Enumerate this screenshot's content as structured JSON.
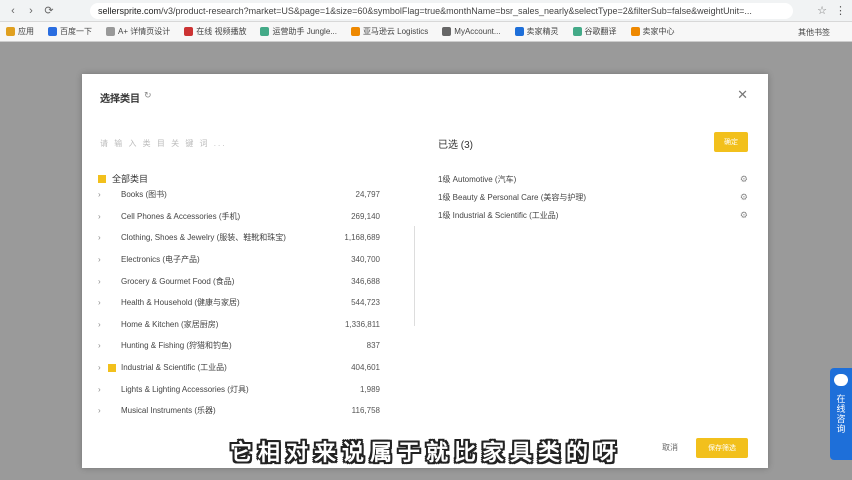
{
  "browser": {
    "url_host": "sellersprite.com",
    "url_path": "/v3/product-research?market=US&page=1&size=60&symbolFlag=true&monthName=bsr_sales_nearly&selectType=2&filterSub=false&weightUnit=..."
  },
  "bookmarks": [
    {
      "label": "应用",
      "color": "#e0a020"
    },
    {
      "label": "百度一下",
      "color": "#2a6de0"
    },
    {
      "label": "A+ 详情页设计",
      "color": "#999"
    },
    {
      "label": "在线 视频播放",
      "color": "#c33"
    },
    {
      "label": "运营助手 Jungle...",
      "color": "#4a8"
    },
    {
      "label": "亚马逊云 Logistics",
      "color": "#e80"
    },
    {
      "label": "MyAccount...",
      "color": "#666"
    },
    {
      "label": "卖家精灵",
      "color": "#1e6fd9"
    },
    {
      "label": "谷歌翻译",
      "color": "#4a8"
    },
    {
      "label": "卖家中心",
      "color": "#e80"
    }
  ],
  "bookmarks_other": "其他书签",
  "modal": {
    "title": "选择类目",
    "search_placeholder": "请 输 入 类 目 关 键 词 ...",
    "all_label": "全部类目",
    "selected_title": "已选 (3)",
    "confirm_label": "确定",
    "cancel_label": "取消",
    "save_label": "保存筛选"
  },
  "categories": [
    {
      "name": "Books (图书)",
      "count": "24,797",
      "checked": false
    },
    {
      "name": "Cell Phones & Accessories (手机)",
      "count": "269,140",
      "checked": false
    },
    {
      "name": "Clothing, Shoes & Jewelry (服装、鞋靴和珠宝)",
      "count": "1,168,689",
      "checked": false
    },
    {
      "name": "Electronics (电子产品)",
      "count": "340,700",
      "checked": false
    },
    {
      "name": "Grocery & Gourmet Food (食品)",
      "count": "346,688",
      "checked": false
    },
    {
      "name": "Health & Household (健康与家居)",
      "count": "544,723",
      "checked": false
    },
    {
      "name": "Home & Kitchen (家居厨房)",
      "count": "1,336,811",
      "checked": false
    },
    {
      "name": "Hunting & Fishing (狩猎和钓鱼)",
      "count": "837",
      "checked": false
    },
    {
      "name": "Industrial & Scientific (工业品)",
      "count": "404,601",
      "checked": true
    },
    {
      "name": "Lights & Lighting Accessories (灯具)",
      "count": "1,989",
      "checked": false
    },
    {
      "name": "Musical Instruments (乐器)",
      "count": "116,758",
      "checked": false
    }
  ],
  "selected": [
    {
      "label": "1级 Automotive (汽车)"
    },
    {
      "label": "1级 Beauty & Personal Care (美容与护理)"
    },
    {
      "label": "1级 Industrial & Scientific (工业品)"
    }
  ],
  "caption": "它相对来说属于就比家具类的呀",
  "float_widget": {
    "label": "在线咨询"
  }
}
